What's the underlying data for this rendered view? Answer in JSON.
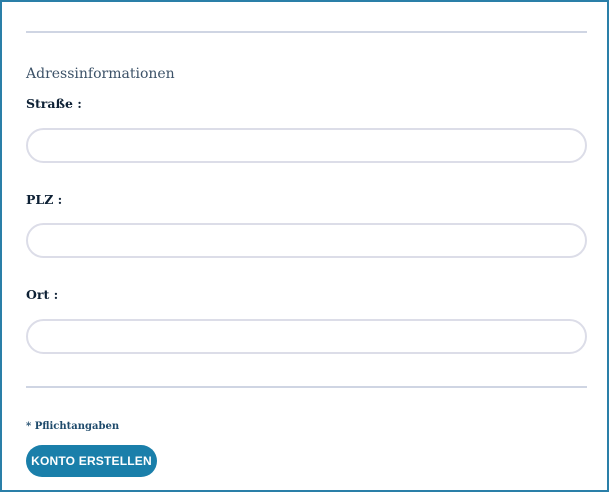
{
  "address_section": {
    "title": "Adressinformationen"
  },
  "fields": {
    "street": {
      "label": "Straße :",
      "value": "",
      "placeholder": ""
    },
    "zip": {
      "label": "PLZ :",
      "value": "",
      "placeholder": ""
    },
    "city": {
      "label": "Ort :",
      "value": "",
      "placeholder": ""
    }
  },
  "footer": {
    "required_note": "* Pflichtangaben",
    "submit_label": "KONTO ERSTELLEN"
  },
  "colors": {
    "frame_border": "#2a7fa8",
    "button_background": "#1a7faa",
    "label_text": "#0e2135",
    "divider": "#cfd5e3",
    "input_border": "#dcdde8"
  }
}
